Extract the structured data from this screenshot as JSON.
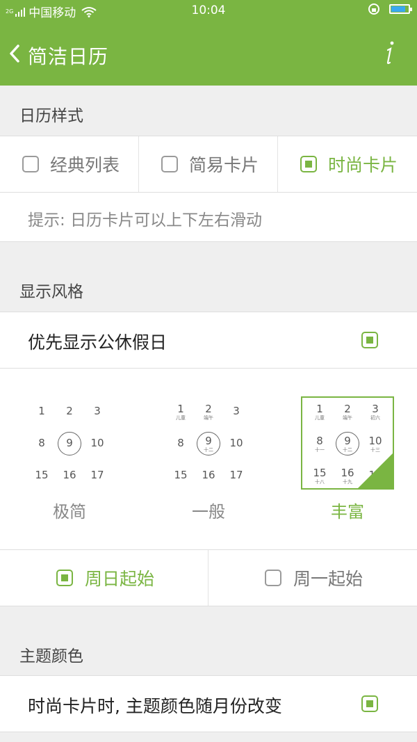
{
  "status": {
    "network": "2G",
    "carrier": "中国移动",
    "time": "10:04",
    "battery_level": 0.85
  },
  "app": {
    "title": "简洁日历",
    "back_icon": "chevron-left-icon",
    "info_icon": "info-icon"
  },
  "colors": {
    "accent": "#7ab542",
    "battery": "#3aa8f0"
  },
  "calendar_style": {
    "header": "日历样式",
    "options": [
      {
        "label": "经典列表",
        "checked": false
      },
      {
        "label": "简易卡片",
        "checked": false
      },
      {
        "label": "时尚卡片",
        "checked": true
      }
    ],
    "hint": "提示: 日历卡片可以上下左右滑动"
  },
  "display_style": {
    "header": "显示风格",
    "holiday_label": "优先显示公休假日",
    "holiday_checked": true,
    "previews": [
      {
        "name": "极简",
        "selected": false,
        "days": [
          {
            "n": "1",
            "l": ""
          },
          {
            "n": "2",
            "l": ""
          },
          {
            "n": "3",
            "l": ""
          },
          {
            "n": "8",
            "l": ""
          },
          {
            "n": "9",
            "l": ""
          },
          {
            "n": "10",
            "l": ""
          },
          {
            "n": "15",
            "l": ""
          },
          {
            "n": "16",
            "l": ""
          },
          {
            "n": "17",
            "l": ""
          }
        ]
      },
      {
        "name": "一般",
        "selected": false,
        "days": [
          {
            "n": "1",
            "l": "儿童"
          },
          {
            "n": "2",
            "l": "端午"
          },
          {
            "n": "3",
            "l": ""
          },
          {
            "n": "8",
            "l": ""
          },
          {
            "n": "9",
            "l": "十二"
          },
          {
            "n": "10",
            "l": ""
          },
          {
            "n": "15",
            "l": ""
          },
          {
            "n": "16",
            "l": ""
          },
          {
            "n": "17",
            "l": ""
          }
        ]
      },
      {
        "name": "丰富",
        "selected": true,
        "days": [
          {
            "n": "1",
            "l": "儿童"
          },
          {
            "n": "2",
            "l": "端午"
          },
          {
            "n": "3",
            "l": "初六"
          },
          {
            "n": "8",
            "l": "十一"
          },
          {
            "n": "9",
            "l": "十二"
          },
          {
            "n": "10",
            "l": "十三"
          },
          {
            "n": "15",
            "l": "十八"
          },
          {
            "n": "16",
            "l": "十九"
          },
          {
            "n": "17",
            "l": ""
          }
        ]
      }
    ],
    "week_start": [
      {
        "label": "周日起始",
        "checked": true
      },
      {
        "label": "周一起始",
        "checked": false
      }
    ]
  },
  "theme": {
    "header": "主题颜色",
    "label": "时尚卡片时, 主题颜色随月份改变",
    "checked": true
  }
}
